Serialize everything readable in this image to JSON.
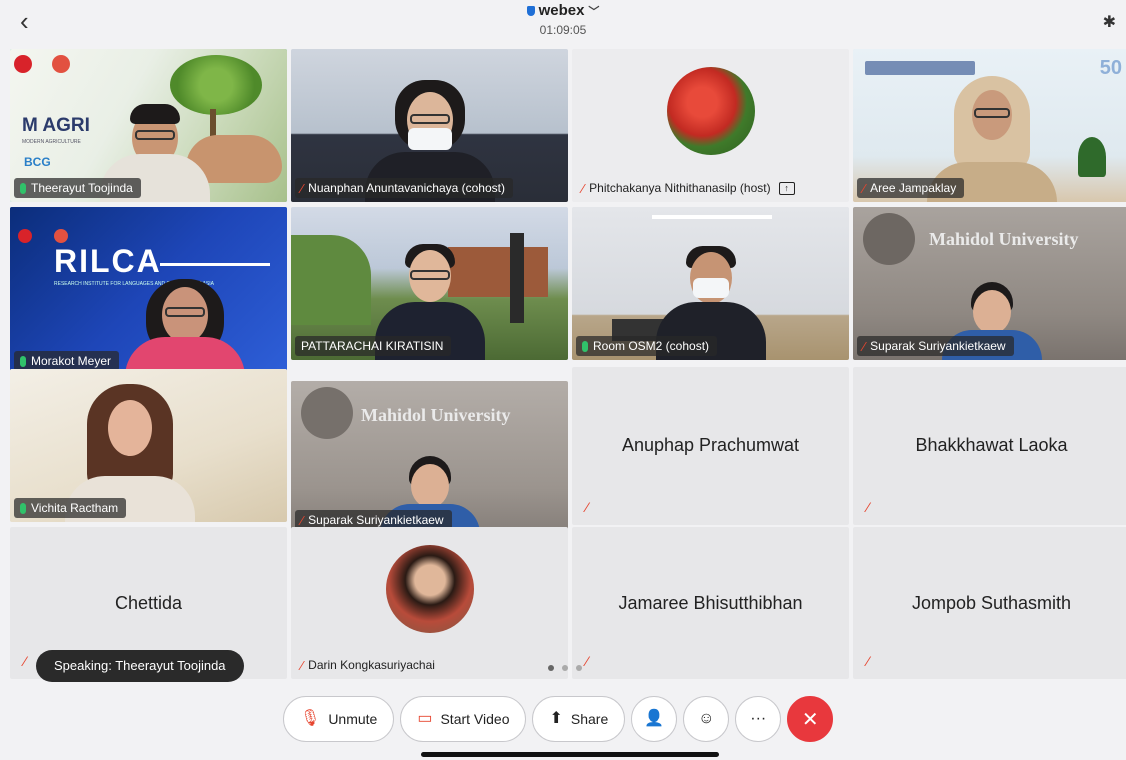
{
  "header": {
    "back_glyph": "‹",
    "app_title": "webex",
    "timer": "01:09:05",
    "bluetooth_glyph": "✱"
  },
  "tiles": {
    "t1": {
      "name": "Theerayut Toojinda",
      "logo": "M AGRI",
      "logo_sub": "MODERN AGRICULTURE",
      "logo2": "BCG"
    },
    "t2": {
      "name": "Nuanphan Anuntavanichaya (cohost)"
    },
    "t3": {
      "name": "Phitchakanya Nithithanasilp (host)"
    },
    "t4": {
      "name": "Aree Jampaklay",
      "badge": "50"
    },
    "t5": {
      "name": "Morakot Meyer",
      "logo": "RILCA",
      "logo_sub": "RESEARCH INSTITUTE FOR LANGUAGES AND CULTURES OF ASIA"
    },
    "t6": {
      "name": "PATTARACHAI KIRATISIN"
    },
    "t7": {
      "name": "Room OSM2 (cohost)"
    },
    "t8": {
      "name": "Suparak Suriyankietkaew",
      "sign": "Mahidol University"
    },
    "t9": {
      "name": "Vichita Ractham"
    },
    "t10": {
      "name": "Suparak Suriyankietkaew",
      "sign": "Mahidol University"
    },
    "t11": {
      "name": "Anuphap Prachumwat"
    },
    "t12": {
      "name": "Bhakkhawat Laoka"
    },
    "t13": {
      "name": "Chettida"
    },
    "t14": {
      "name": "Darin Kongkasuriyachai"
    },
    "t15": {
      "name": "Jamaree Bhisutthibhan"
    },
    "t16": {
      "name": "Jompob Suthasmith"
    }
  },
  "speaking": "Speaking: Theerayut Toojinda",
  "controls": {
    "unmute": "Unmute",
    "start_video": "Start Video",
    "share": "Share",
    "more": "···",
    "end": "✕"
  },
  "colors": {
    "active_border": "#4fc3b6",
    "mic_on": "#30c26a",
    "mic_off": "#e6452f",
    "end_button": "#e8383d"
  }
}
